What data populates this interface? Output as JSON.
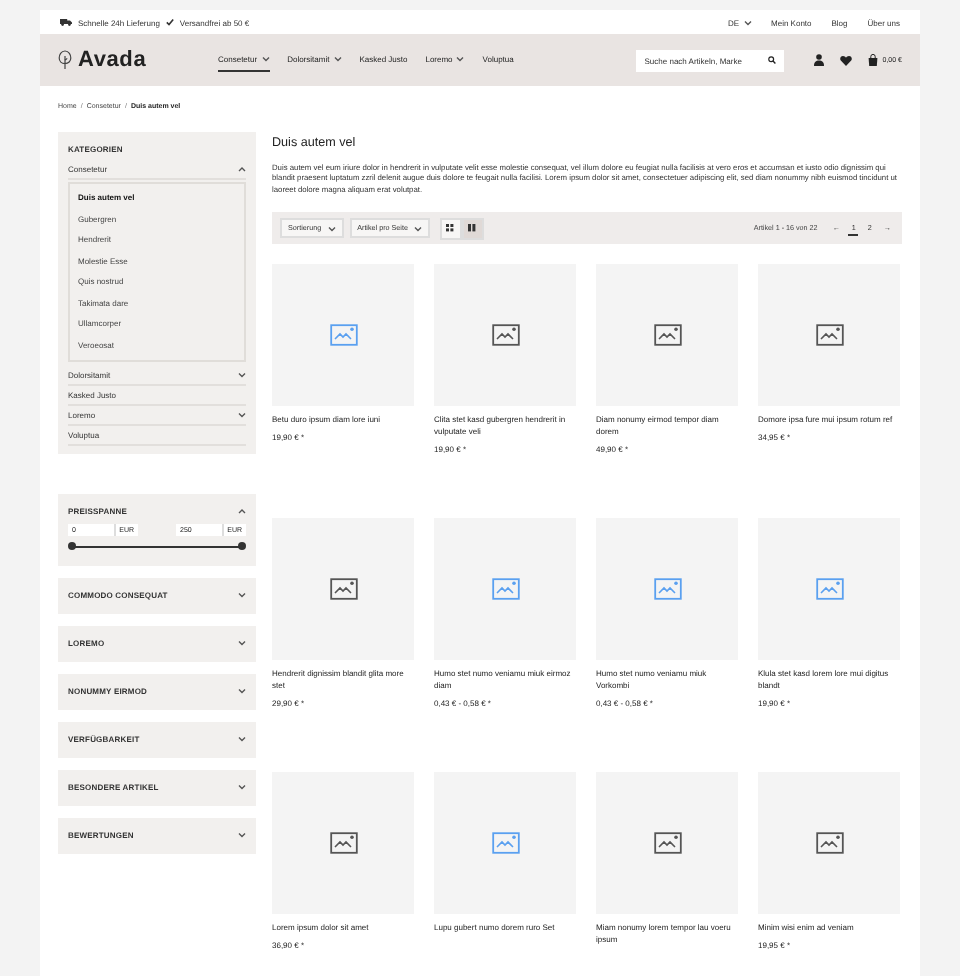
{
  "top_bar": {
    "delivery": "Schnelle 24h Lieferung",
    "shipping": "Versandfrei ab 50 €",
    "language": "DE",
    "links": [
      "Mein Konto",
      "Blog",
      "Über uns"
    ]
  },
  "header": {
    "logo": "Avada",
    "nav": [
      {
        "label": "Consetetur",
        "dropdown": true,
        "selected": true
      },
      {
        "label": "Dolorsitamit",
        "dropdown": true,
        "selected": false
      },
      {
        "label": "Kasked Justo",
        "dropdown": false,
        "selected": false
      },
      {
        "label": "Loremo",
        "dropdown": true,
        "selected": false
      },
      {
        "label": "Voluptua",
        "dropdown": false,
        "selected": false
      }
    ],
    "search": {
      "placeholder": "Suche nach Artikeln, Marke"
    },
    "cart_total": "0,00 €"
  },
  "breadcrumb": {
    "separator": "/",
    "items": [
      "Home",
      "Consetetur",
      "Duis autem vel"
    ]
  },
  "sidebar": {
    "categories_title": "KATEGORIEN",
    "categories": [
      {
        "label": "Consetetur",
        "expanded": true,
        "has_children": true,
        "children": [
          {
            "label": "Duis autem vel",
            "selected": true
          },
          {
            "label": "Gubergren",
            "selected": false
          },
          {
            "label": "Hendrerit",
            "selected": false
          },
          {
            "label": "Molestie Esse",
            "selected": false
          },
          {
            "label": "Quis nostrud",
            "selected": false
          },
          {
            "label": "Takimata dare",
            "selected": false
          },
          {
            "label": "Ullamcorper",
            "selected": false
          },
          {
            "label": "Veroeosat",
            "selected": false
          }
        ]
      },
      {
        "label": "Dolorsitamit",
        "expanded": false,
        "has_children": true
      },
      {
        "label": "Kasked Justo",
        "has_children": false
      },
      {
        "label": "Loremo",
        "expanded": false,
        "has_children": true
      },
      {
        "label": "Voluptua",
        "has_children": false
      }
    ],
    "price": {
      "title": "PREISSPANNE",
      "min": "0",
      "max": "250",
      "unit_min": "EUR",
      "unit_max": "EUR",
      "low": {
        "level": 0
      },
      "high": {
        "level": 1
      }
    },
    "filters": [
      {
        "label": "COMMODO CONSEQUAT",
        "expanded": false
      },
      {
        "label": "LOREMO",
        "expanded": false
      },
      {
        "label": "NONUMMY EIRMOD",
        "expanded": false
      },
      {
        "label": "VERFÜGBARKEIT",
        "expanded": false
      },
      {
        "label": "BESONDERE ARTIKEL",
        "expanded": false
      },
      {
        "label": "BEWERTUNGEN",
        "expanded": false
      }
    ]
  },
  "main": {
    "title": "Duis autem vel",
    "description": "Duis autem vel eum iriure dolor in hendrerit in vulputate velit esse molestie consequat, vel illum dolore eu feugiat nulla facilisis at vero eros et accumsan et iusto odio dignissim qui blandit praesent luptatum zzril delenit augue duis dolore te feugait nulla facilisi. Lorem ipsum dolor sit amet, consectetuer adipiscing elit, sed diam nonummy nibh euismod tincidunt ut laoreet dolore magna aliquam erat volutpat.",
    "toolbar": {
      "sort": "Sortierung",
      "per_page": "Artikel pro Seite",
      "views": [
        {
          "kind": "list",
          "selected": false
        },
        {
          "kind": "grid",
          "selected": true
        }
      ],
      "count": "Artikel 1 - 16 von 22",
      "prev": "←",
      "pages": [
        {
          "label": "1",
          "selected": true
        },
        {
          "label": "2",
          "selected": false
        }
      ],
      "next": "→"
    },
    "products": [
      {
        "name": "Betu duro ipsum diam lore iuni",
        "price": "19,90 € *",
        "color": "#5aa0f0"
      },
      {
        "name": "Clita stet kasd gubergren hendrerit in vulputate veli",
        "price": "19,90 € *",
        "color": "#555555"
      },
      {
        "name": "Diam nonumy eirmod tempor diam dorem",
        "price": "49,90 € *",
        "color": "#555555"
      },
      {
        "name": "Domore ipsa fure mui ipsum rotum ref",
        "price": "34,95 € *",
        "color": "#555555"
      },
      {
        "name": "Hendrerit dignissim blandit glita more stet",
        "price": "29,90 € *",
        "color": "#555555"
      },
      {
        "name": "Humo stet numo veniamu miuk eirmoz diam",
        "price": "0,43 € - 0,58 € *",
        "color": "#5aa0f0"
      },
      {
        "name": "Humo stet numo veniamu miuk Vorkombi",
        "price": "0,43 € - 0,58 € *",
        "color": "#5aa0f0"
      },
      {
        "name": "Klula stet kasd lorem lore mui digitus blandt",
        "price": "19,90 € *",
        "color": "#5aa0f0"
      },
      {
        "name": "Lorem ipsum dolor sit amet",
        "price": "36,90 € *",
        "color": "#555555"
      },
      {
        "name": "Lupu gubert numo dorem ruro Set",
        "color": "#5aa0f0"
      },
      {
        "name": "Miam nonumy lorem tempor lau voeru ipsum",
        "color": "#555555"
      },
      {
        "name": "Minim wisi enim ad veniam",
        "price": "19,95 € *",
        "color": "#555555"
      }
    ]
  }
}
